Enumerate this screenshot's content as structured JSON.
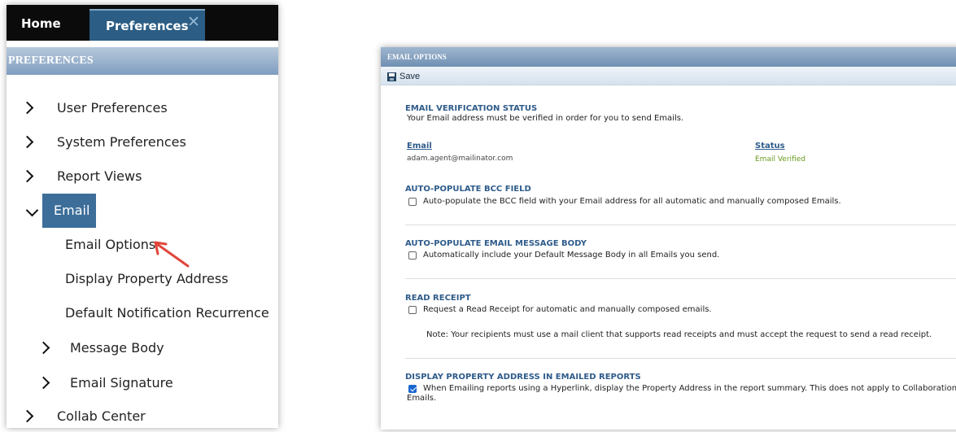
{
  "left": {
    "tabs": {
      "home": "Home",
      "preferences": "Preferences",
      "close": "✕"
    },
    "header": "PREFERENCES",
    "nav": [
      {
        "label": "User Preferences",
        "expanded": false
      },
      {
        "label": "System Preferences",
        "expanded": false
      },
      {
        "label": "Report Views",
        "expanded": false
      },
      {
        "label": "Email",
        "expanded": true
      },
      {
        "label": "Email Options"
      },
      {
        "label": "Display Property Address"
      },
      {
        "label": "Default Notification Recurrence"
      },
      {
        "label": "Message Body",
        "expanded": false
      },
      {
        "label": "Email Signature",
        "expanded": false
      },
      {
        "label": "Collab Center",
        "expanded": false
      }
    ]
  },
  "right": {
    "header": "EMAIL OPTIONS",
    "toolbar": {
      "save": "Save"
    },
    "verification": {
      "title": "EMAIL VERIFICATION STATUS",
      "text": "Your Email address must be verified in order for you to send Emails.",
      "email_head": "Email",
      "email_value": "adam.agent@mailinator.com",
      "status_head": "Status",
      "status_value": "Email Verified"
    },
    "bcc": {
      "title": "AUTO-POPULATE BCC FIELD",
      "text": "Auto-populate the BCC field with your Email address for all automatic and manually composed Emails.",
      "checked": false
    },
    "body": {
      "title": "AUTO-POPULATE EMAIL MESSAGE BODY",
      "text": "Automatically include your Default Message Body in all Emails you send.",
      "checked": false
    },
    "receipt": {
      "title": "READ RECEIPT",
      "text": "Request a Read Receipt for automatic and manually composed emails.",
      "note": "Note: Your recipients must use a mail client that supports read receipts and must accept the request to send a read receipt.",
      "checked": false
    },
    "address": {
      "title": "DISPLAY PROPERTY ADDRESS IN EMAILED REPORTS",
      "text": "When Emailing reports using a Hyperlink, display the Property Address in the report summary. This does not apply to Collaboration Center",
      "text2": "Emails.",
      "checked": true
    }
  },
  "colors": {
    "accent": "#2e5b8a",
    "tab_active": "#2c5d84",
    "email_selected": "#3d6e9a",
    "status_ok": "#6a9a1f",
    "arrow": "#e0463a"
  }
}
